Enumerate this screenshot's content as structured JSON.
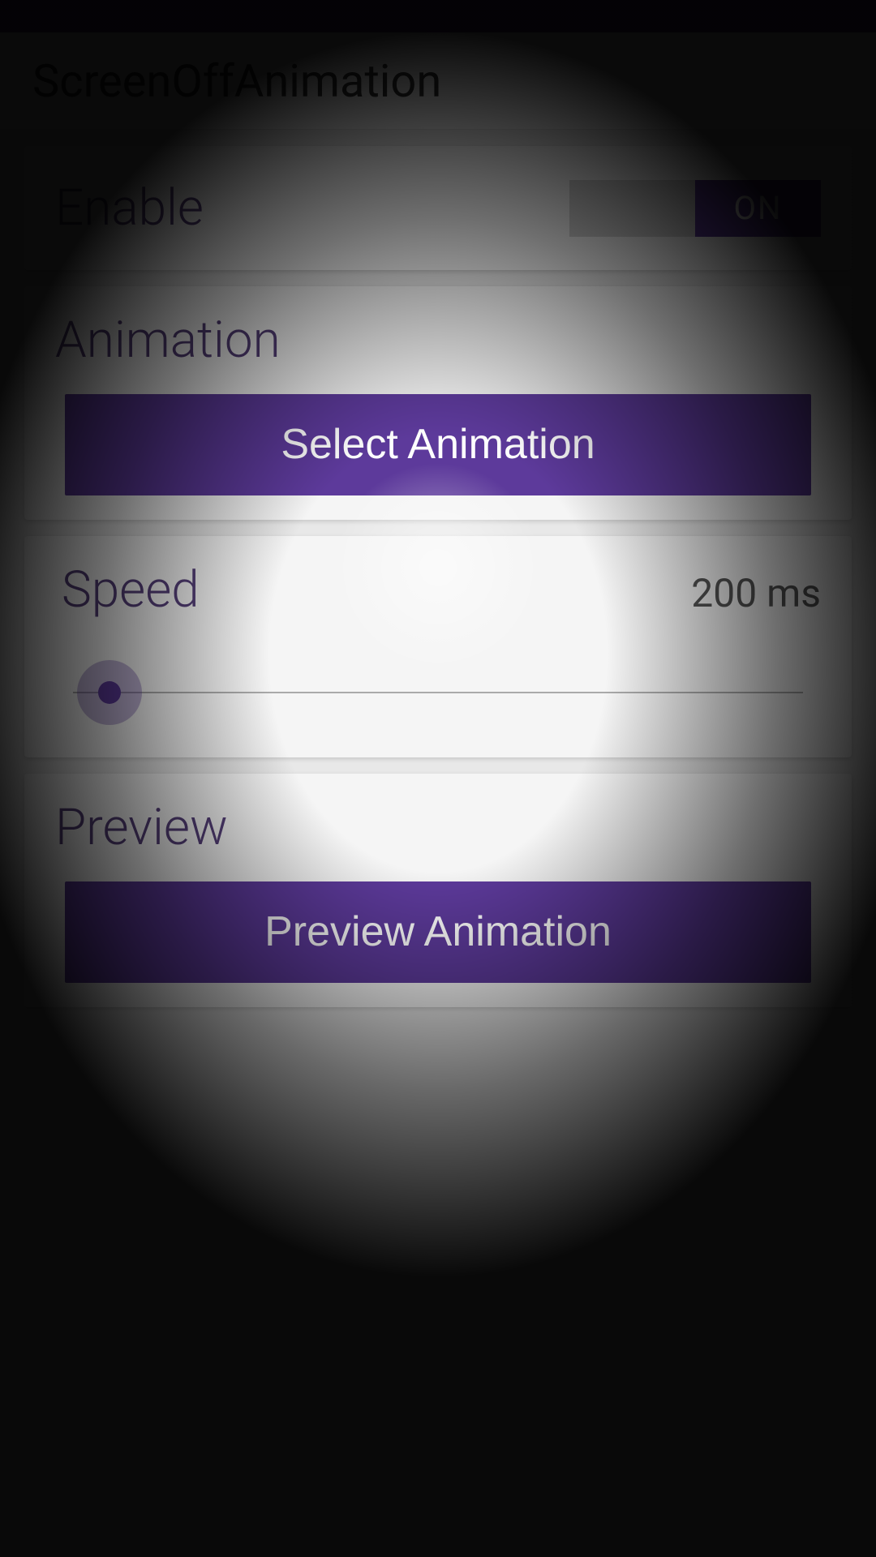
{
  "app": {
    "title": "ScreenOffAnimation"
  },
  "enable": {
    "label": "Enable",
    "toggle_state": "ON"
  },
  "animation": {
    "title": "Animation",
    "select_button": "Select Animation"
  },
  "speed": {
    "title": "Speed",
    "value": "200 ms",
    "slider_percent": 5
  },
  "preview": {
    "title": "Preview",
    "button": "Preview Animation"
  },
  "colors": {
    "accent": "#5d3a9b",
    "accent_light": "#56407a"
  }
}
